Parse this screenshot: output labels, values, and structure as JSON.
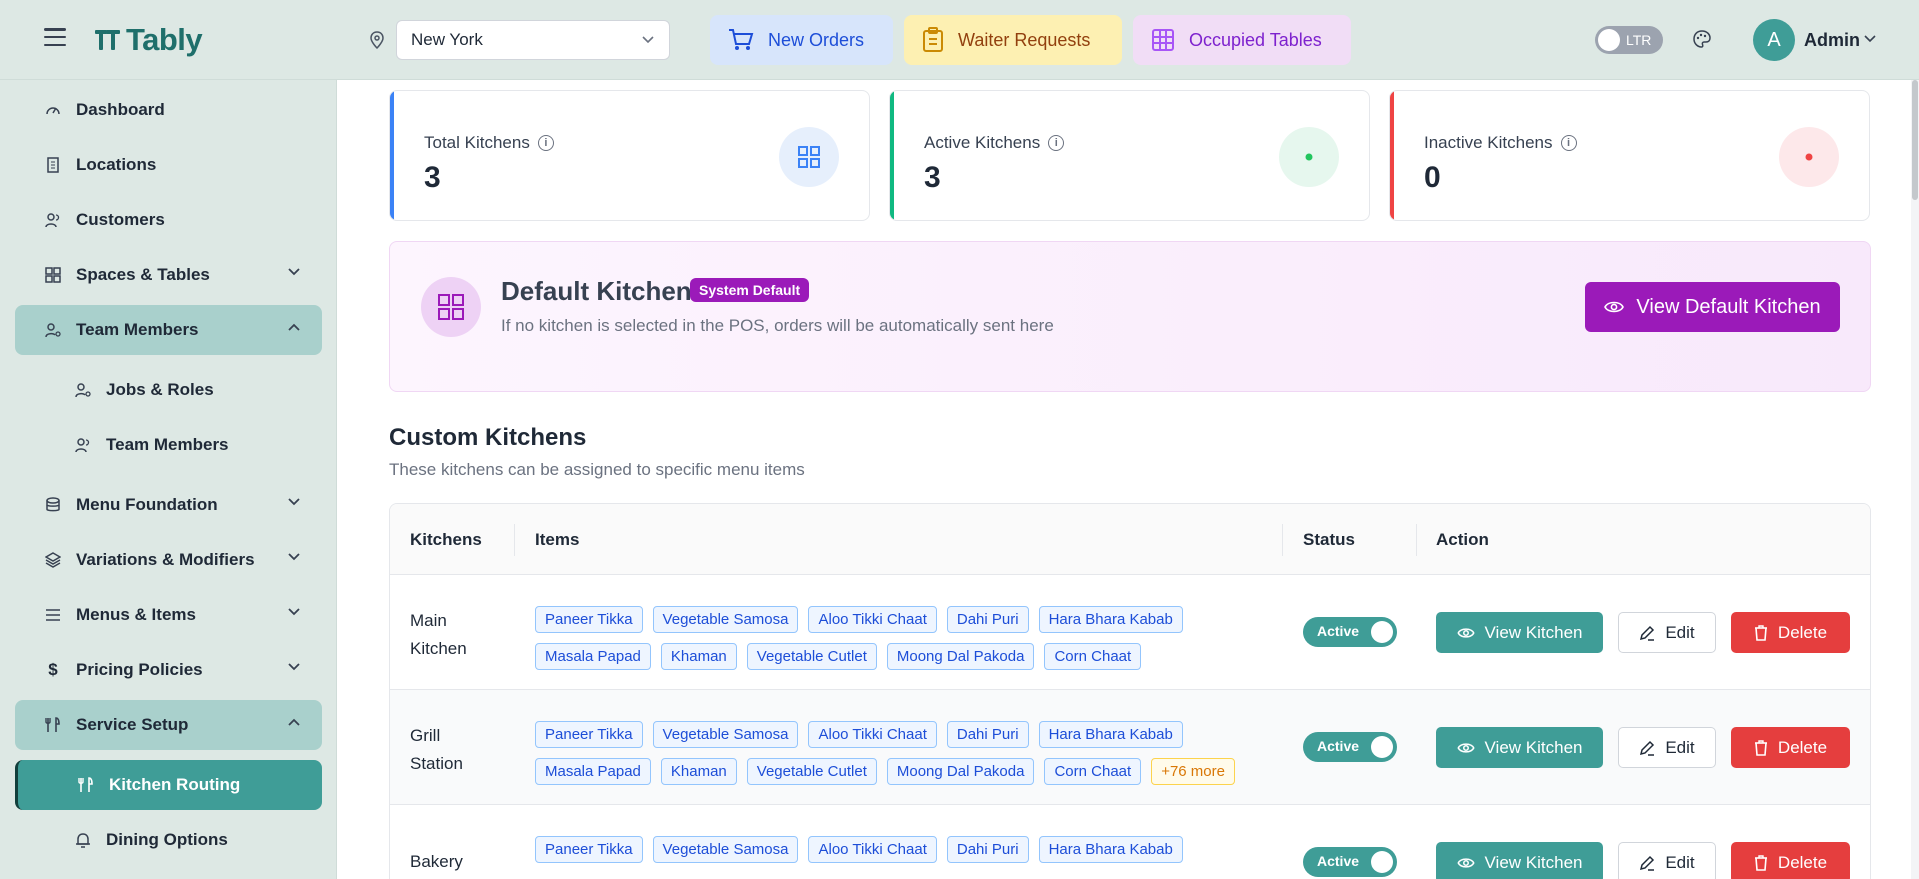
{
  "header": {
    "logo_text": "Tably",
    "location": "New York",
    "quick": {
      "new_orders": "New Orders",
      "waiter_requests": "Waiter Requests",
      "occupied_tables": "Occupied Tables"
    },
    "direction_label": "LTR",
    "avatar_initial": "A",
    "user_name": "Admin"
  },
  "sidebar": {
    "items": [
      {
        "label": "Dashboard"
      },
      {
        "label": "Locations"
      },
      {
        "label": "Customers"
      },
      {
        "label": "Spaces & Tables"
      },
      {
        "label": "Team Members"
      },
      {
        "label": "Jobs & Roles"
      },
      {
        "label": "Team Members"
      },
      {
        "label": "Menu Foundation"
      },
      {
        "label": "Variations & Modifiers"
      },
      {
        "label": "Menus & Items"
      },
      {
        "label": "Pricing Policies"
      },
      {
        "label": "Service Setup"
      },
      {
        "label": "Kitchen Routing"
      },
      {
        "label": "Dining Options"
      }
    ]
  },
  "stats": {
    "total": {
      "label": "Total Kitchens",
      "value": "3"
    },
    "active": {
      "label": "Active Kitchens",
      "value": "3"
    },
    "inactive": {
      "label": "Inactive Kitchens",
      "value": "0"
    }
  },
  "default_kitchen": {
    "title": "Default Kitchen",
    "badge": "System Default",
    "description": "If no kitchen is selected in the POS, orders will be automatically sent here",
    "button": "View Default Kitchen"
  },
  "custom": {
    "title": "Custom Kitchens",
    "subtitle": "These kitchens can be assigned to specific menu items",
    "columns": {
      "kitchens": "Kitchens",
      "items": "Items",
      "status": "Status",
      "action": "Action"
    },
    "rows": [
      {
        "name_line1": "Main",
        "name_line2": "Kitchen",
        "items": [
          "Paneer Tikka",
          "Vegetable Samosa",
          "Aloo Tikki Chaat",
          "Dahi Puri",
          "Hara Bhara Kabab",
          "Masala Papad",
          "Khaman",
          "Vegetable Cutlet",
          "Moong Dal Pakoda",
          "Corn Chaat"
        ],
        "status": "Active"
      },
      {
        "name_line1": "Grill",
        "name_line2": "Station",
        "items": [
          "Paneer Tikka",
          "Vegetable Samosa",
          "Aloo Tikki Chaat",
          "Dahi Puri",
          "Hara Bhara Kabab",
          "Masala Papad",
          "Khaman",
          "Vegetable Cutlet",
          "Moong Dal Pakoda",
          "Corn Chaat"
        ],
        "more": "+76 more",
        "status": "Active"
      },
      {
        "name_line1": "Bakery",
        "name_line2": "",
        "items": [
          "Paneer Tikka",
          "Vegetable Samosa",
          "Aloo Tikki Chaat",
          "Dahi Puri",
          "Hara Bhara Kabab"
        ],
        "status": "Active"
      }
    ],
    "actions": {
      "view": "View Kitchen",
      "edit": "Edit",
      "delete": "Delete"
    }
  },
  "colors": {
    "primary": "#3f9d97",
    "accent_purple": "#9b1ab9",
    "danger": "#e53e3e",
    "sidebar_bg": "#dde8e4"
  }
}
